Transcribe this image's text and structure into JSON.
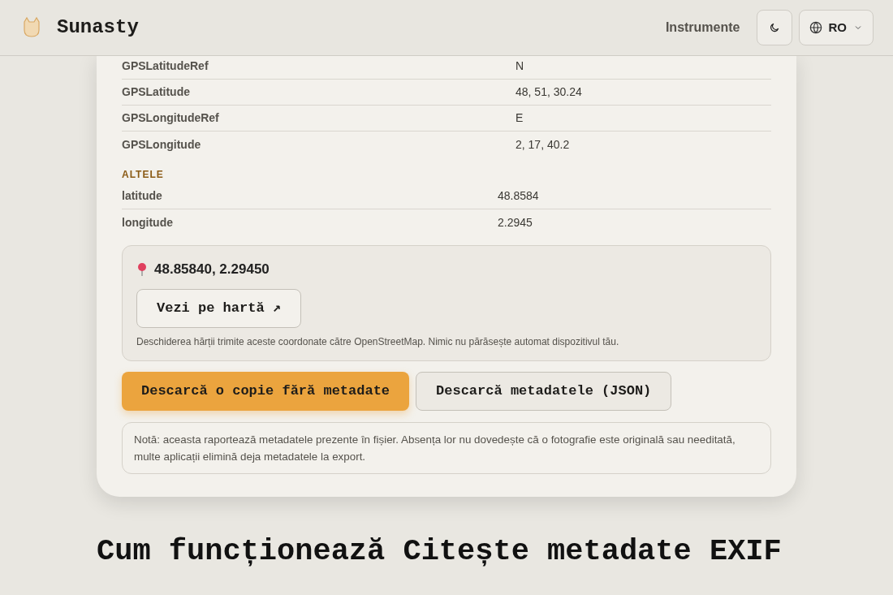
{
  "header": {
    "brand": "Sunasty",
    "nav_link": "Instrumente",
    "language": "RO"
  },
  "gps_rows": [
    {
      "key": "GPSLatitudeRef",
      "value": "N"
    },
    {
      "key": "GPSLatitude",
      "value": "48, 51, 30.24"
    },
    {
      "key": "GPSLongitudeRef",
      "value": "E"
    },
    {
      "key": "GPSLongitude",
      "value": "2, 17, 40.2"
    }
  ],
  "other_section": {
    "title": "ALTELE",
    "rows": [
      {
        "key": "latitude",
        "value": "48.8584"
      },
      {
        "key": "longitude",
        "value": "2.2945"
      }
    ]
  },
  "location": {
    "coordinates": "48.85840, 2.29450",
    "map_button": "Vezi pe hartă ↗",
    "privacy_note": "Deschiderea hărții trimite aceste coordonate către OpenStreetMap. Nimic nu părăsește automat dispozitivul tău."
  },
  "actions": [
    {
      "label": "Descarcă o copie fără metadate",
      "kind": "primary"
    },
    {
      "label": "Descarcă metadatele (JSON)",
      "kind": "secondary"
    }
  ],
  "note": "Notă: aceasta raportează metadatele prezente în fișier. Absența lor nu dovedește că o fotografie este originală sau needitată, multe aplicații elimină deja metadatele la export.",
  "section_heading": "Cum funcționează Citește metadate EXIF"
}
